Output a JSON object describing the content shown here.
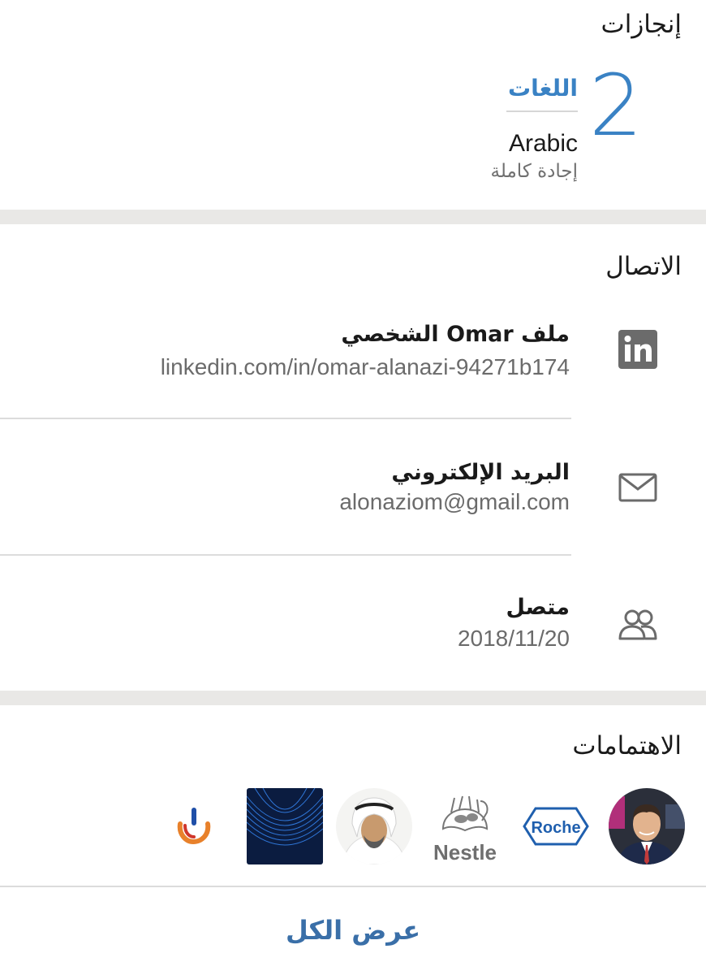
{
  "achievements": {
    "title": "إنجازات",
    "count": "2",
    "label": "اللغات",
    "language": "Arabic",
    "proficiency": "إجادة كاملة"
  },
  "contact": {
    "title": "الاتصال",
    "items": [
      {
        "title": "ملف Omar الشخصي",
        "value": "linkedin.com/in/omar-alanazi-94271b174",
        "icon": "linkedin-icon"
      },
      {
        "title": "البريد الإلكتروني",
        "value": "alonaziom@gmail.com",
        "icon": "mail-icon"
      },
      {
        "title": "متصل",
        "value": "2018/11/20",
        "icon": "people-icon"
      }
    ]
  },
  "interests": {
    "title": "الاهتمامات",
    "items": [
      {
        "name": "person-avatar"
      },
      {
        "name": "roche-logo",
        "text": "Roche"
      },
      {
        "name": "nestle-logo",
        "text": "Nestle"
      },
      {
        "name": "sheikh-avatar"
      },
      {
        "name": "abstract-lines-logo"
      },
      {
        "name": "orange-blue-logo"
      }
    ],
    "see_all": "عرض الكل"
  },
  "colors": {
    "accent": "#3a82c4",
    "link": "#3a6fa8",
    "background": "#e9e8e6",
    "roche_blue": "#1f5fae"
  }
}
